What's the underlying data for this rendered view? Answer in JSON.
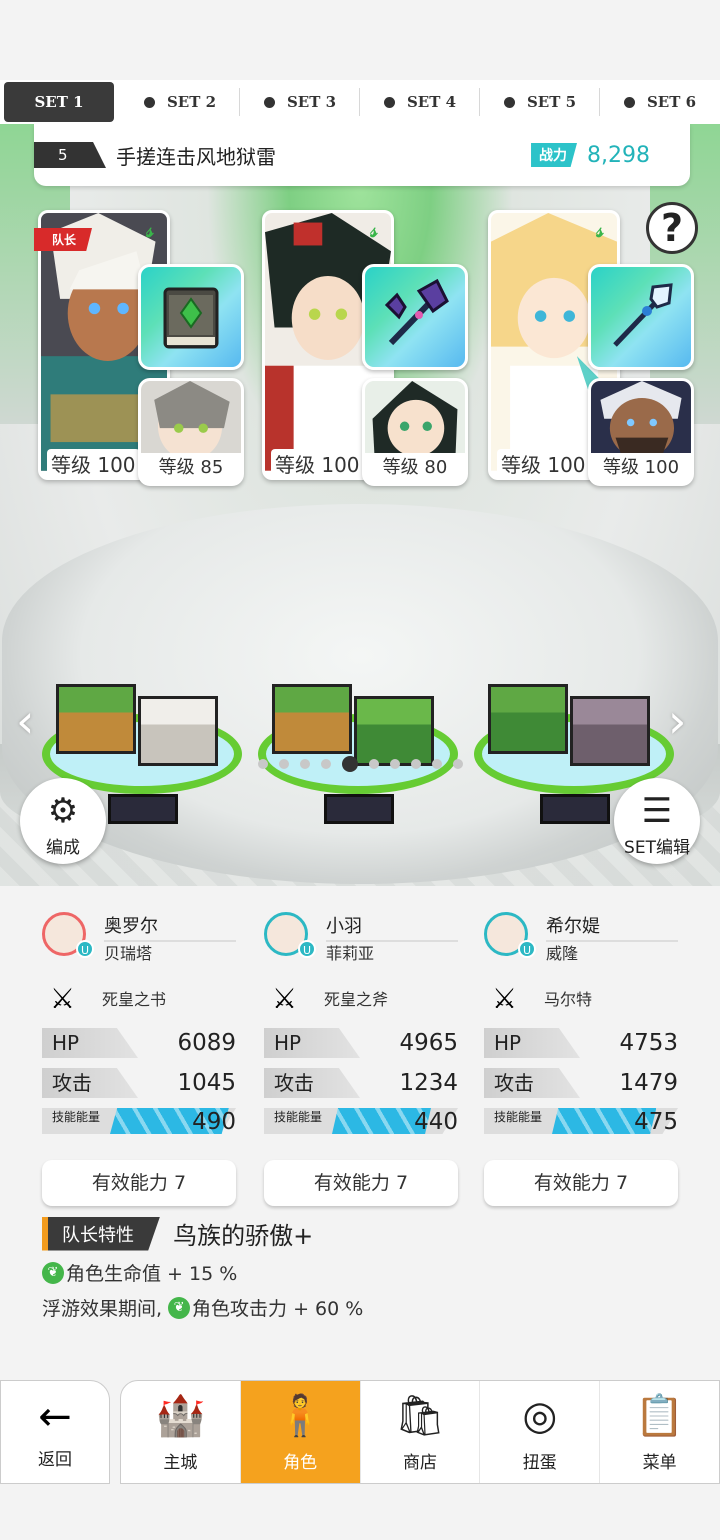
{
  "tabs": [
    {
      "label": "SET 1"
    },
    {
      "label": "SET 2"
    },
    {
      "label": "SET 3"
    },
    {
      "label": "SET 4"
    },
    {
      "label": "SET 5"
    },
    {
      "label": "SET 6"
    }
  ],
  "team": {
    "number": "5",
    "name": "手搓连击风地狱雷",
    "power_label": "战力",
    "power_value": "8,298",
    "captain_badge": "队长"
  },
  "units": [
    {
      "main_level": "等级 100",
      "sub_level": "等级 85"
    },
    {
      "main_level": "等级 100",
      "sub_level": "等级 80"
    },
    {
      "main_level": "等级 100",
      "sub_level": "等级 100"
    }
  ],
  "pager": {
    "total": 10,
    "current": 5
  },
  "buttons": {
    "formation": "编成",
    "set_edit": "SET编辑"
  },
  "stats": [
    {
      "name": "奥罗尔",
      "sub_name": "贝瑞塔",
      "badge": "U",
      "weapon": "死皇之书",
      "hp_label": "HP",
      "hp": "6089",
      "atk_label": "攻击",
      "atk": "1045",
      "energy_label": "技能能量",
      "energy": "490",
      "energy_fill": 0.66,
      "effective": "有效能力 7"
    },
    {
      "name": "小羽",
      "sub_name": "菲莉亚",
      "badge": "U",
      "weapon": "死皇之斧",
      "hp_label": "HP",
      "hp": "4965",
      "atk_label": "攻击",
      "atk": "1234",
      "energy_label": "技能能量",
      "energy": "440",
      "energy_fill": 0.55,
      "effective": "有效能力 7"
    },
    {
      "name": "希尔媞",
      "sub_name": "威隆",
      "badge": "U",
      "weapon": "马尔特",
      "hp_label": "HP",
      "hp": "4753",
      "atk_label": "攻击",
      "atk": "1479",
      "energy_label": "技能能量",
      "energy": "475",
      "energy_fill": 0.58,
      "effective": "有效能力 7"
    }
  ],
  "trait": {
    "tag": "队长特性",
    "name": "鸟族的骄傲+",
    "line1": "角色生命值 + 15 %",
    "line2_prefix": "浮游效果期间,",
    "line2": "角色攻击力 + 60 %"
  },
  "nav": {
    "back": "返回",
    "items": [
      {
        "label": "主城",
        "icon": "castle-icon"
      },
      {
        "label": "角色",
        "icon": "character-icon"
      },
      {
        "label": "商店",
        "icon": "shop-icon"
      },
      {
        "label": "扭蛋",
        "icon": "gacha-icon"
      },
      {
        "label": "菜单",
        "icon": "menu-icon"
      }
    ]
  },
  "colors": {
    "accent": "#f5a21e",
    "power": "#2cc3c9",
    "leaf": "#39b54a",
    "captain": "#d82a2a"
  }
}
